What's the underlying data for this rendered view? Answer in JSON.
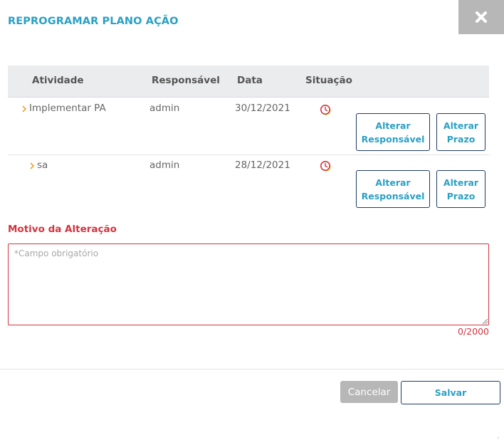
{
  "dialog": {
    "title": "REPROGRAMAR PLANO AÇÃO",
    "close_icon": "close-icon"
  },
  "table": {
    "headers": {
      "atividade": "Atividade",
      "responsavel": "Responsável",
      "data": "Data",
      "situacao": "Situação"
    },
    "rows": [
      {
        "atividade": "Implementar PA",
        "responsavel": "admin",
        "data": "30/12/2021",
        "situacao_icon": "late-clock-icon",
        "btn_responsavel": "Alterar Responsável",
        "btn_prazo": "Alterar Prazo"
      },
      {
        "atividade": "sa",
        "responsavel": "admin",
        "data": "28/12/2021",
        "situacao_icon": "late-clock-icon",
        "btn_responsavel": "Alterar Responsável",
        "btn_prazo": "Alterar Prazo"
      }
    ]
  },
  "motivo": {
    "label": "Motivo da Alteração",
    "placeholder": "*Campo obrigatório",
    "value": "",
    "counter": "0/2000"
  },
  "footer": {
    "cancel_label": "Cancelar",
    "save_label": "Salvar"
  },
  "colors": {
    "accent": "#2aa0c4",
    "error": "#d2343f",
    "button_border": "#1e3a66",
    "header_bg": "#ebecee",
    "cancel_bg": "#b7b7b7",
    "chevron": "#f0a030"
  }
}
